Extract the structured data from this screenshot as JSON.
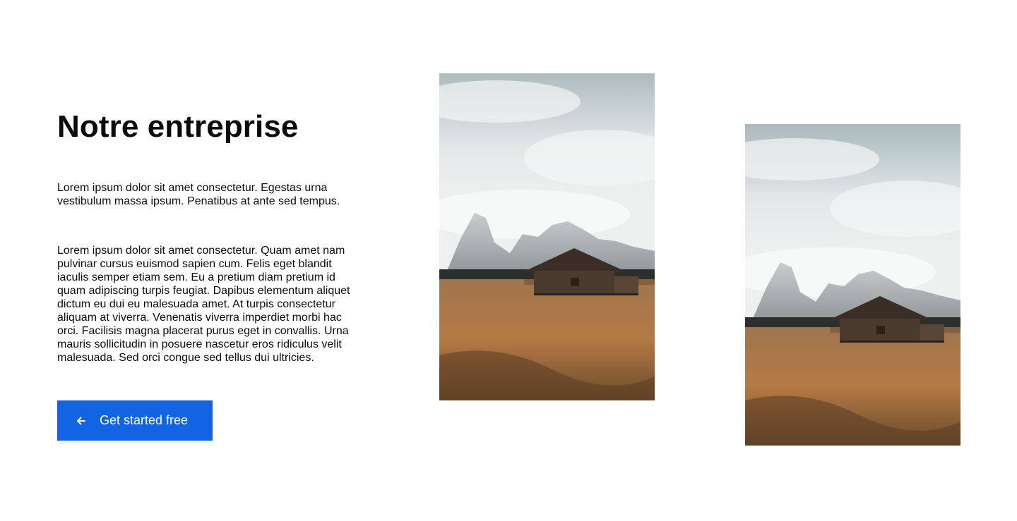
{
  "section": {
    "title": "Notre entreprise",
    "paragraph_1": "Lorem ipsum dolor sit amet consectetur. Egestas urna vestibulum massa ipsum. Penatibus at ante sed tempus.",
    "paragraph_2": "Lorem ipsum dolor sit amet consectetur. Quam amet nam pulvinar cursus euismod sapien cum. Felis eget blandit iaculis semper etiam sem. Eu a pretium diam pretium id quam adipiscing turpis feugiat. Dapibus elementum aliquet dictum eu dui eu malesuada amet. At turpis consectetur aliquam at viverra. Venenatis viverra imperdiet morbi hac orci. Facilisis magna placerat purus eget in convallis. Urna mauris sollicitudin in posuere nascetur eros ridiculus velit malesuada. Sed orci congue sed tellus dui ultricies.",
    "cta": {
      "label": "Get started free",
      "icon": "arrow-left-icon",
      "color": "#1264e3"
    }
  },
  "images": [
    {
      "subject": "wooden cabin in a meadow with mountains"
    },
    {
      "subject": "wooden cabin in a meadow with mountains"
    }
  ]
}
